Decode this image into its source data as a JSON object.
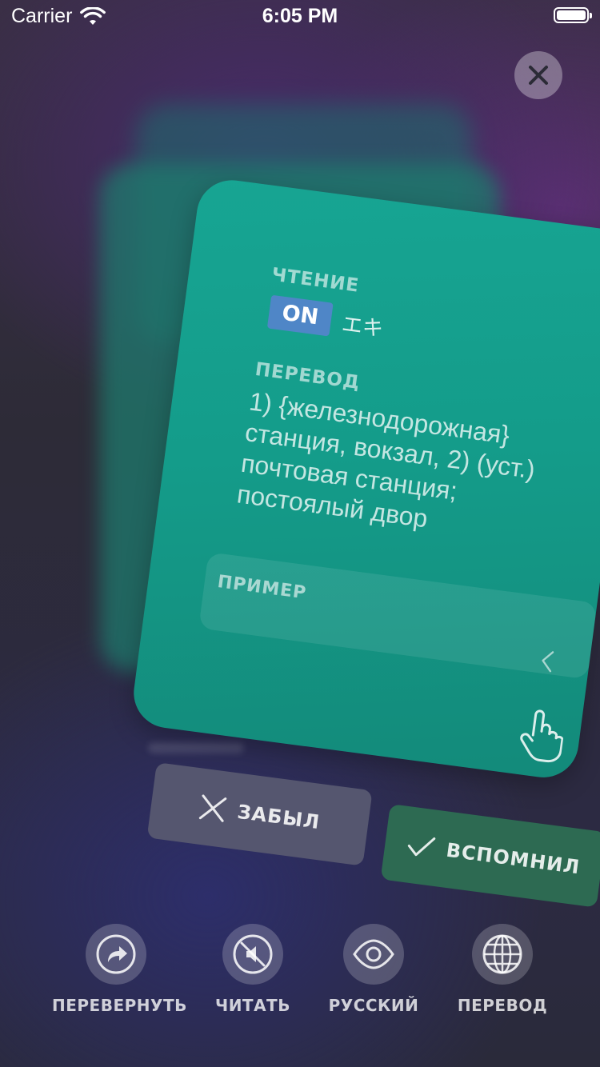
{
  "status_bar": {
    "carrier": "Carrier",
    "time": "6:05 PM"
  },
  "card": {
    "reading_label": "ЧТЕНИЕ",
    "reading_toggle": "ON",
    "reading_kana": "エキ",
    "translation_label": "ПЕРЕВОД",
    "translation_text": "1) {железнодорожная}\nстанция, вокзал, 2) (уст.)\nпочтовая станция;\nпостоялый двор",
    "example_label": "ПРИМЕР"
  },
  "actions": {
    "forgot": "ЗАБЫЛ",
    "remembered": "ВСПОМНИЛ"
  },
  "toolbar": {
    "flip": "ПЕРЕВЕРНУТЬ",
    "read": "ЧИТАТЬ",
    "language": "РУССКИЙ",
    "translation": "ПЕРЕВОД"
  },
  "colors": {
    "card": "#17a593",
    "on_badge": "#4f86c7",
    "remember": "#2d6a52",
    "forgot": "#55566f"
  },
  "icons": [
    "wifi-icon",
    "battery-icon",
    "close-icon",
    "chevron-left-icon",
    "tap-hand-icon",
    "x-icon",
    "check-icon",
    "flip-icon",
    "mute-icon",
    "eye-icon",
    "globe-icon"
  ]
}
